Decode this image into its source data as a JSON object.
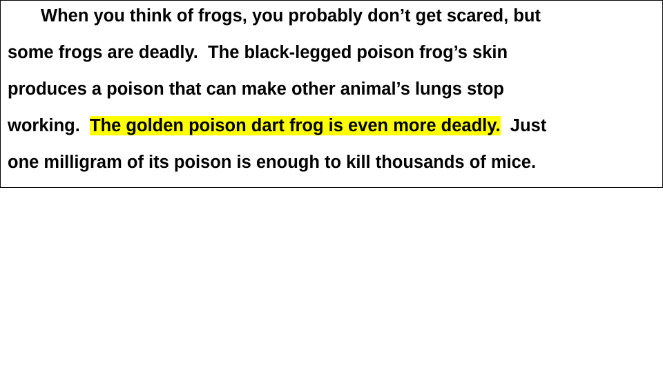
{
  "paragraph": {
    "line1": "When you think of frogs, you probably don’t get scared, but",
    "line2": "some frogs are deadly.  The black-legged poison frog’s skin",
    "line3": "produces a poison that can make other animal’s lungs stop",
    "line4_before": "working.  ",
    "line4_highlight": "The golden poison dart frog is even more deadly.",
    "line4_after": "  Just",
    "line5": "one milligram of its poison is enough to kill thousands of mice."
  },
  "colors": {
    "highlight": "#ffff00",
    "text": "#000000",
    "border": "#000000"
  }
}
